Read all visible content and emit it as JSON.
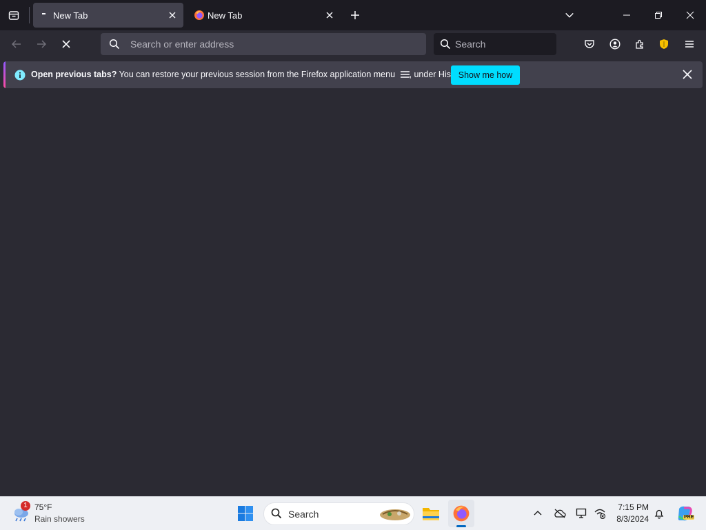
{
  "tabs": [
    {
      "title": "New Tab",
      "active": true
    },
    {
      "title": "New Tab",
      "active": false
    }
  ],
  "urlbar": {
    "placeholder": "Search or enter address",
    "value": ""
  },
  "searchbar": {
    "placeholder": "Search"
  },
  "notification": {
    "bold": "Open previous tabs?",
    "message": " You can restore your previous session from the Firefox application menu",
    "suffix": ", under History.",
    "button": "Show me how"
  },
  "taskbar": {
    "weather_temp": "75°F",
    "weather_desc": "Rain showers",
    "weather_badge": "1",
    "search_placeholder": "Search",
    "time": "7:15 PM",
    "date": "8/3/2024",
    "copilot_badge": "PRE"
  },
  "colors": {
    "tabbar": "#1c1b22",
    "toolbar": "#2b2a33",
    "active_tab": "#42414d",
    "accent": "#00ddff",
    "taskbar": "#eef0f4"
  }
}
